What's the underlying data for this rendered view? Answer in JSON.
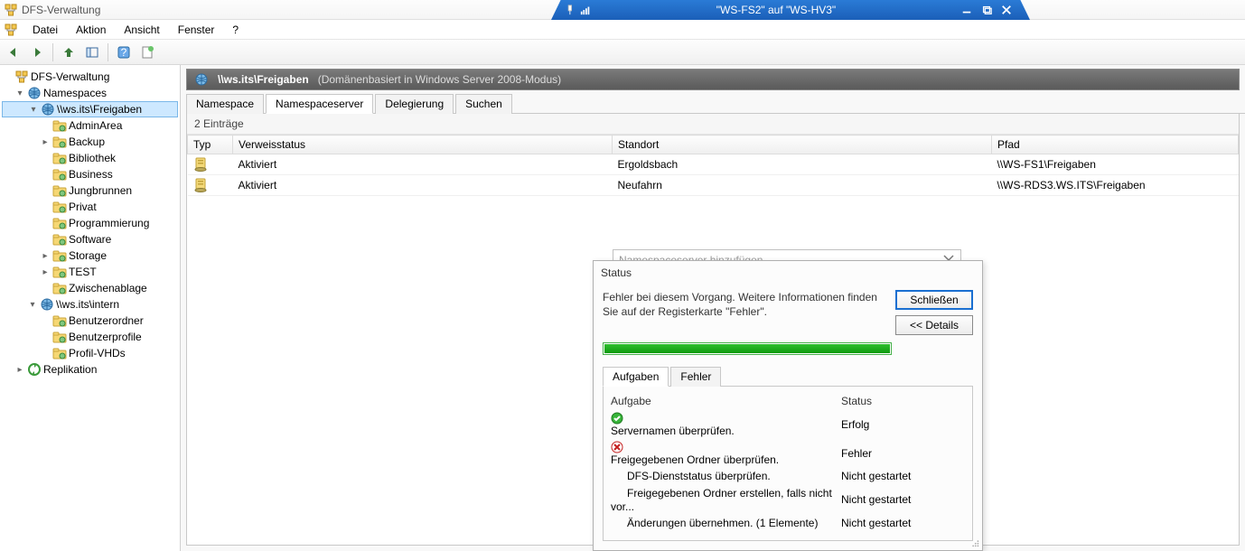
{
  "titlebar": {
    "app_title": "DFS-Verwaltung"
  },
  "remote": {
    "title": "\"WS-FS2\" auf \"WS-HV3\""
  },
  "menu": {
    "file": "Datei",
    "action": "Aktion",
    "view": "Ansicht",
    "window": "Fenster",
    "help": "?"
  },
  "sidebar": {
    "root": "DFS-Verwaltung",
    "namespaces": "Namespaces",
    "ns_path": "\\\\ws.its\\Freigaben",
    "folders": [
      "AdminArea",
      "Backup",
      "Bibliothek",
      "Business",
      "Jungbrunnen",
      "Privat",
      "Programmierung",
      "Software",
      "Storage",
      "TEST",
      "Zwischenablage"
    ],
    "intern": "\\\\ws.its\\intern",
    "intern_items": [
      "Benutzerordner",
      "Benutzerprofile",
      "Profil-VHDs"
    ],
    "replication": "Replikation"
  },
  "content": {
    "path": "\\\\ws.its\\Freigaben",
    "subtitle": "(Domänenbasiert in Windows Server 2008-Modus)",
    "tabs": {
      "namespace": "Namespace",
      "servers": "Namespaceserver",
      "delegation": "Delegierung",
      "search": "Suchen"
    },
    "entries": "2 Einträge",
    "cols": {
      "type": "Typ",
      "refstatus": "Verweisstatus",
      "site": "Standort",
      "path": "Pfad"
    },
    "rows": [
      {
        "status": "Aktiviert",
        "site": "Ergoldsbach",
        "path": "\\\\WS-FS1\\Freigaben"
      },
      {
        "status": "Aktiviert",
        "site": "Neufahrn",
        "path": "\\\\WS-RDS3.WS.ITS\\Freigaben"
      }
    ],
    "addbox_title": "Namespaceserver hinzufügen"
  },
  "dialog": {
    "title": "Status",
    "message": "Fehler bei diesem Vorgang. Weitere Informationen finden Sie auf der Registerkarte \"Fehler\".",
    "close": "Schließen",
    "details": "<< Details",
    "tabs": {
      "tasks": "Aufgaben",
      "errors": "Fehler"
    },
    "task_col": "Aufgabe",
    "status_col": "Status",
    "tasks": [
      {
        "icon": "ok",
        "name": "Servernamen überprüfen.",
        "status": "Erfolg"
      },
      {
        "icon": "err",
        "name": "Freigegebenen Ordner überprüfen.",
        "status": "Fehler"
      },
      {
        "icon": "none",
        "name": "DFS-Dienststatus überprüfen.",
        "status": "Nicht gestartet"
      },
      {
        "icon": "none",
        "name": "Freigegebenen Ordner erstellen, falls nicht vor...",
        "status": "Nicht gestartet"
      },
      {
        "icon": "none",
        "name": "Änderungen übernehmen. (1 Elemente)",
        "status": "Nicht gestartet"
      }
    ]
  }
}
